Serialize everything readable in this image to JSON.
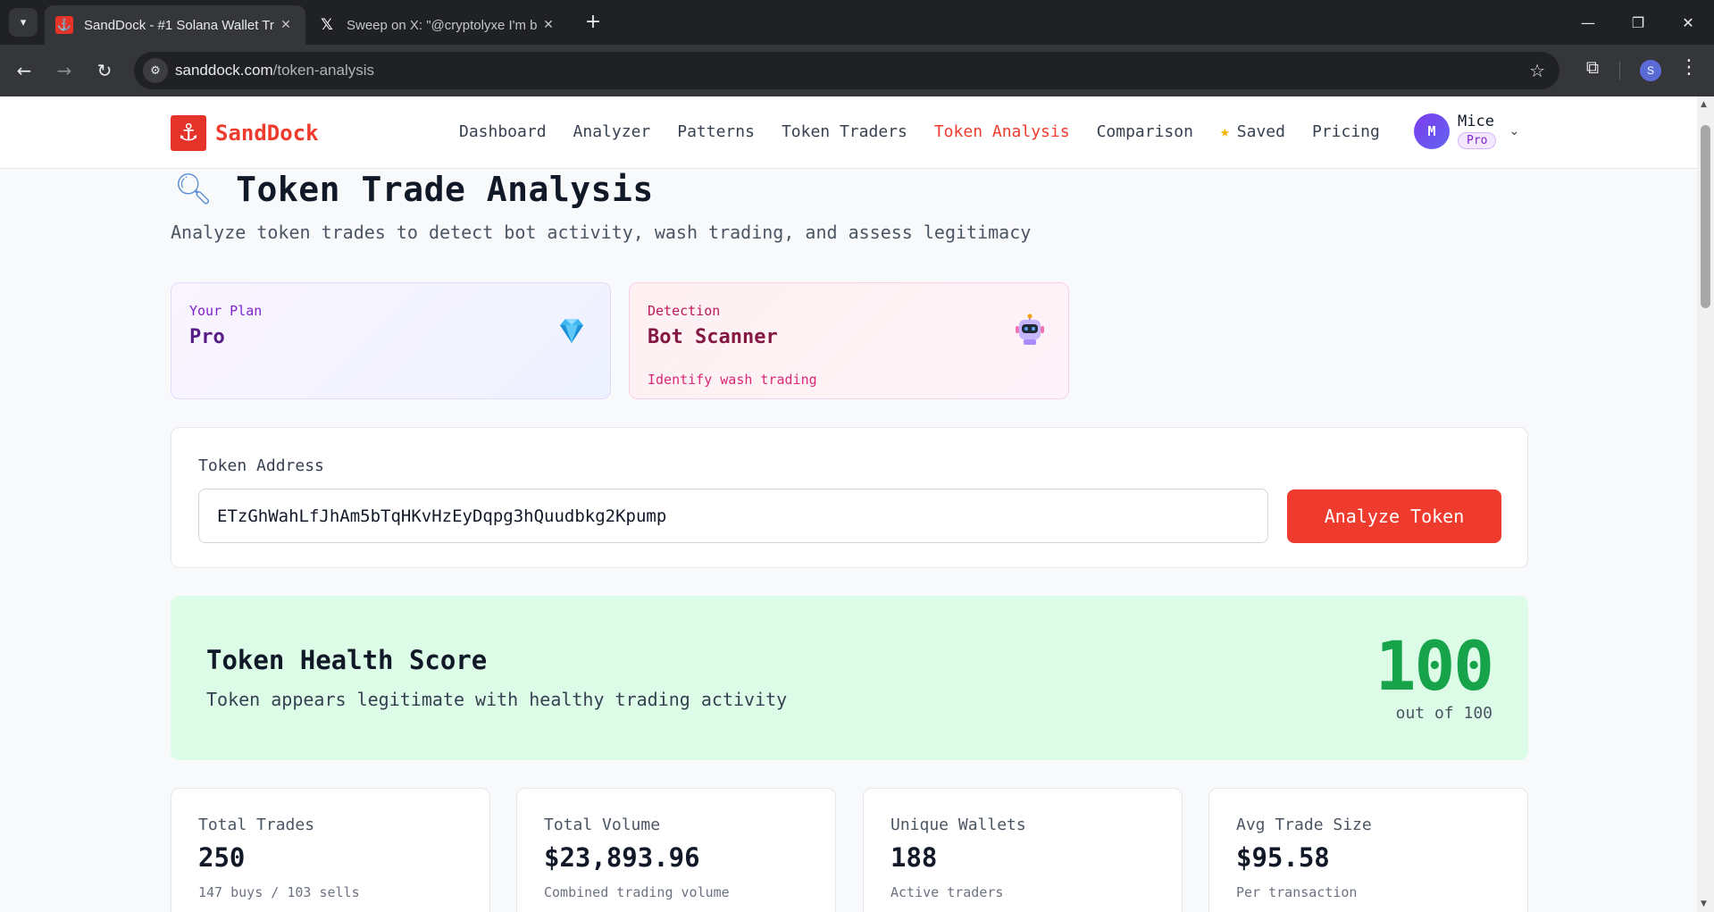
{
  "browser": {
    "tabs": [
      {
        "title": "SandDock - #1 Solana Wallet Tr",
        "active": true
      },
      {
        "title": "Sweep on X: \"@cryptolyxe I'm b",
        "active": false
      }
    ],
    "url_domain": "sanddock.com",
    "url_path": "/token-analysis",
    "profile_initial": "S"
  },
  "header": {
    "logo_text": "SandDock",
    "nav": [
      {
        "label": "Dashboard"
      },
      {
        "label": "Analyzer"
      },
      {
        "label": "Patterns"
      },
      {
        "label": "Token Traders"
      },
      {
        "label": "Token Analysis",
        "active": true
      },
      {
        "label": "Comparison"
      },
      {
        "label": "Saved",
        "icon": "star-icon"
      },
      {
        "label": "Pricing"
      }
    ],
    "user": {
      "initial": "M",
      "name": "Mice",
      "badge": "Pro"
    }
  },
  "page": {
    "title": "Token Trade Analysis",
    "subtitle": "Analyze token trades to detect bot activity, wash trading, and assess legitimacy"
  },
  "plan_card": {
    "label": "Your Plan",
    "value": "Pro",
    "icon": "gem-icon"
  },
  "detection_card": {
    "label": "Detection",
    "value": "Bot Scanner",
    "sub": "Identify wash trading",
    "icon": "robot-icon"
  },
  "token_form": {
    "label": "Token Address",
    "value": "ETzGhWahLfJhAm5bTqHKvHzEyDqpg3hQuudbkg2Kpump",
    "button": "Analyze Token"
  },
  "health": {
    "title": "Token Health Score",
    "description": "Token appears legitimate with healthy trading activity",
    "score": "100",
    "score_of": "out of 100",
    "color": "#16a34a"
  },
  "stats": [
    {
      "label": "Total Trades",
      "value": "250",
      "sub": "147 buys / 103 sells"
    },
    {
      "label": "Total Volume",
      "value": "$23,893.96",
      "sub": "Combined trading volume"
    },
    {
      "label": "Unique Wallets",
      "value": "188",
      "sub": "Active traders"
    },
    {
      "label": "Avg Trade Size",
      "value": "$95.58",
      "sub": "Per transaction"
    }
  ],
  "colors": {
    "accent": "#ef3b2d"
  }
}
